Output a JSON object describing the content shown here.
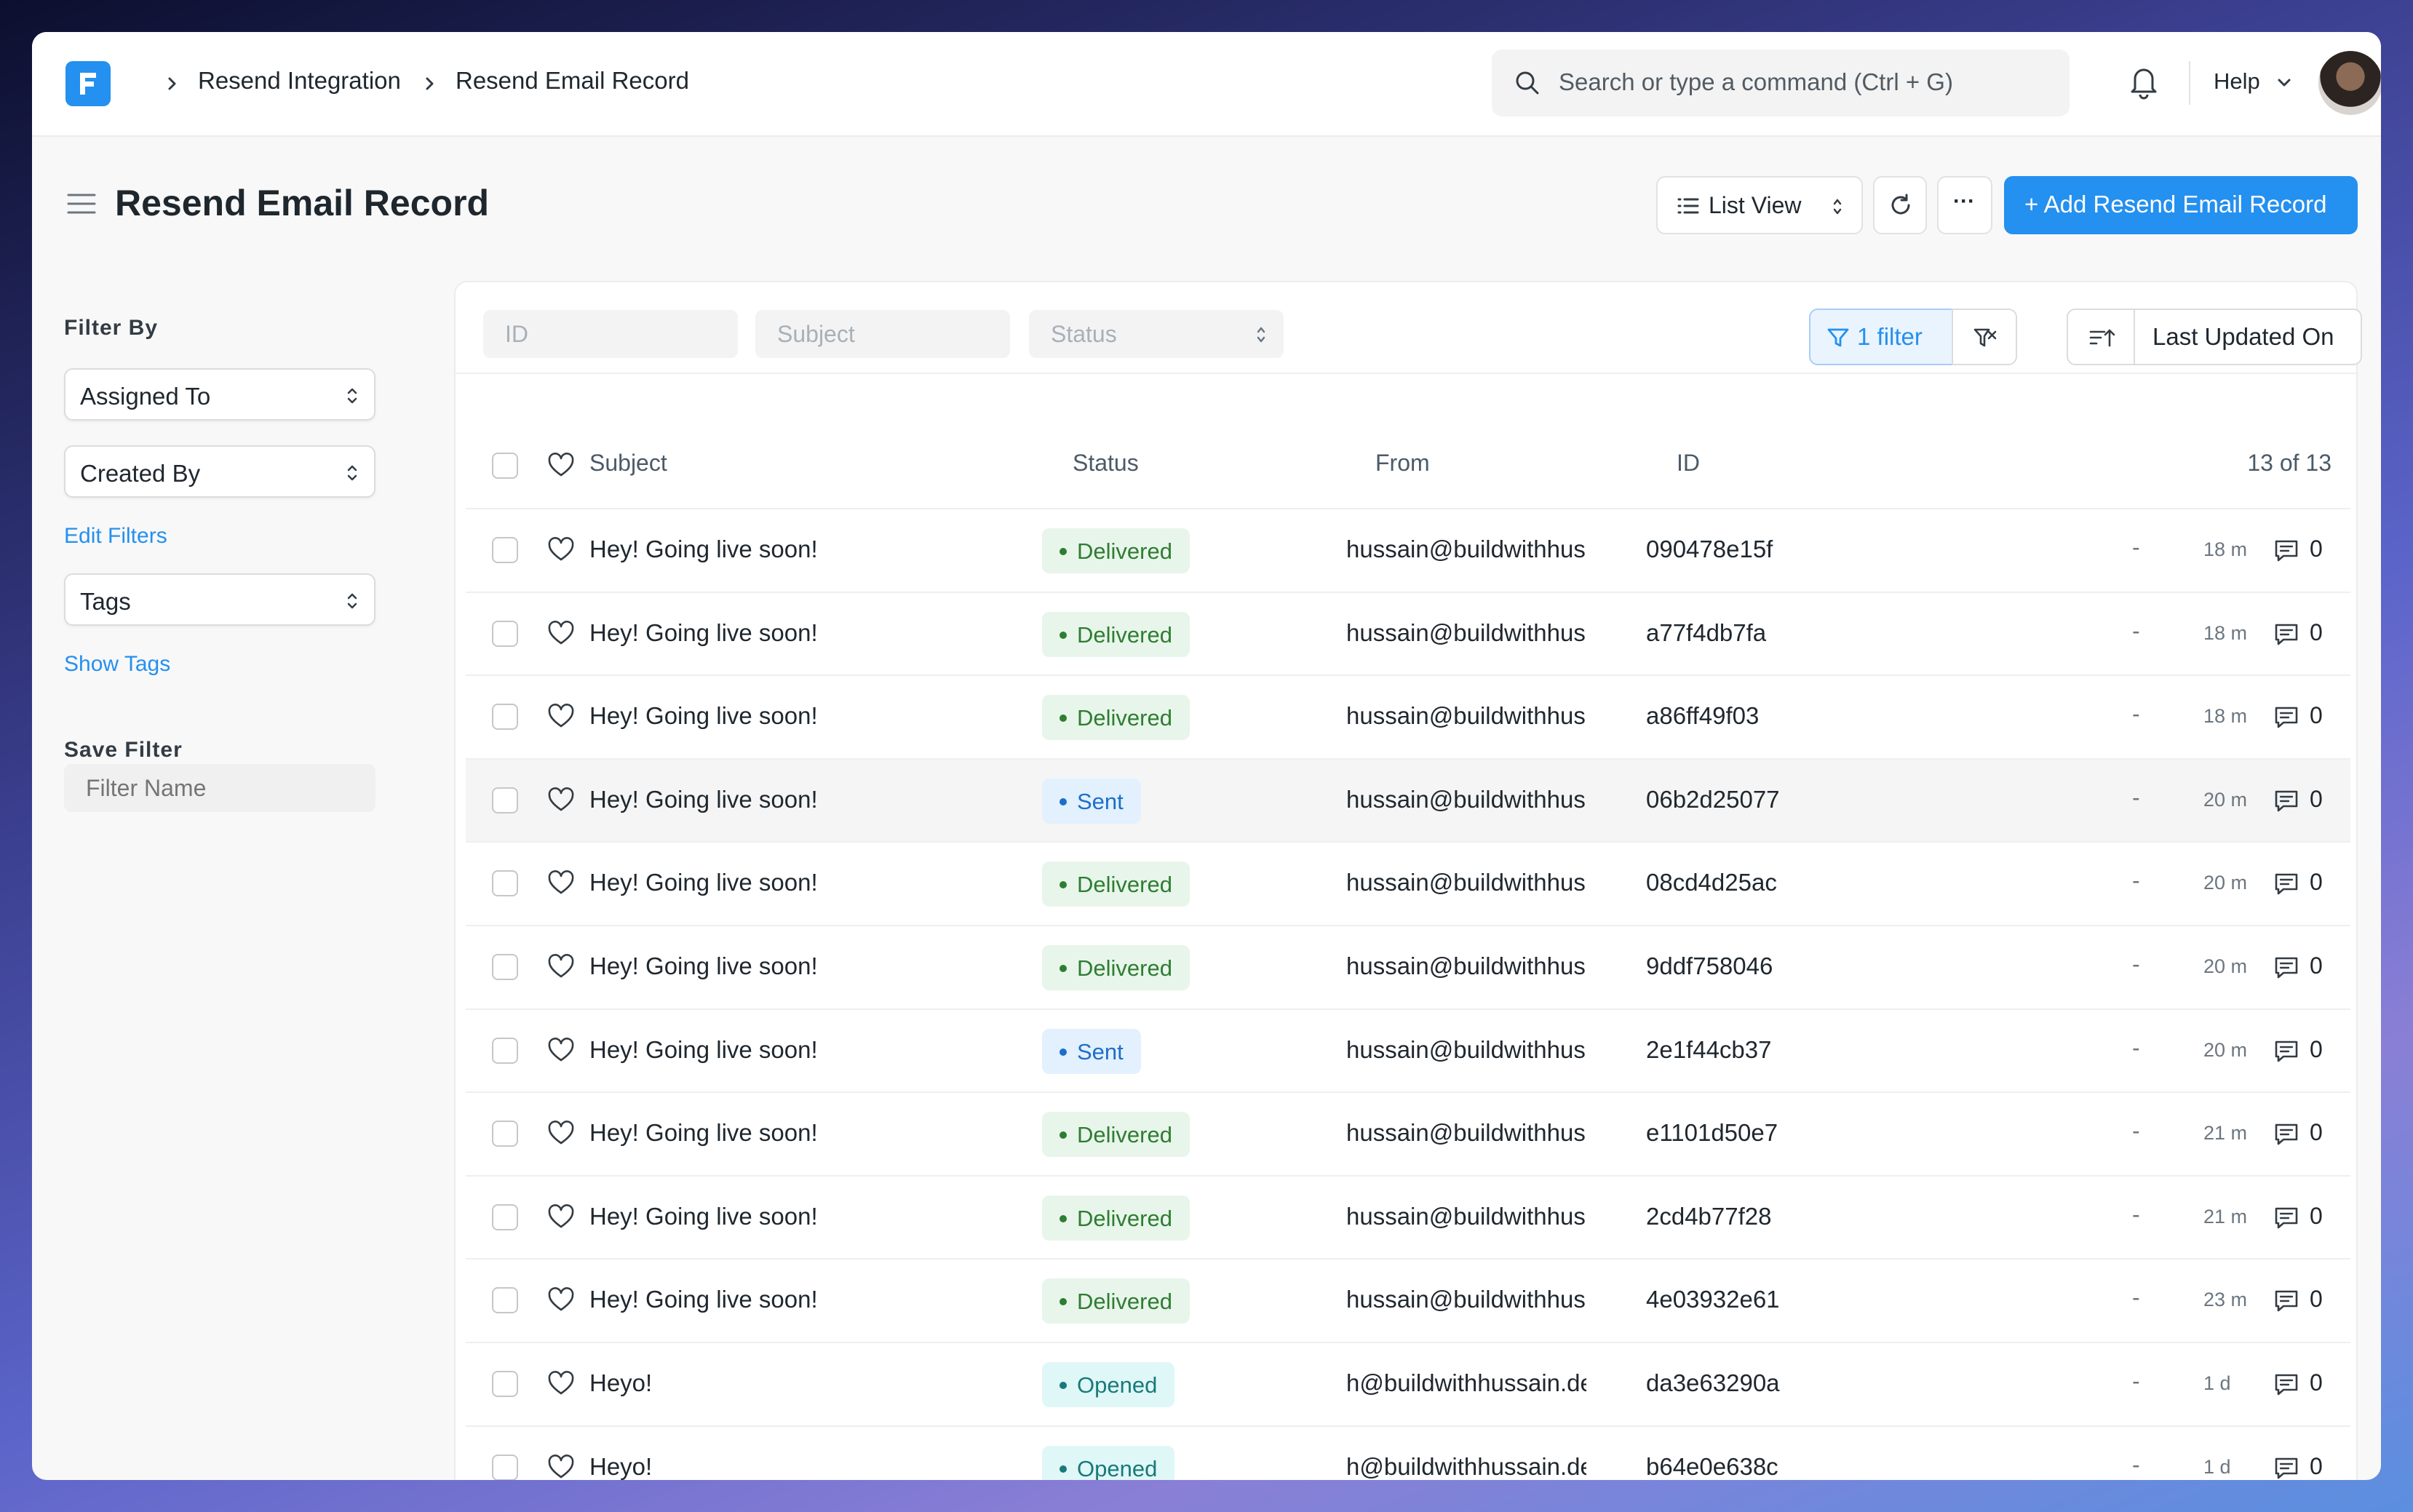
{
  "navbar": {
    "breadcrumbs": [
      "Resend Integration",
      "Resend Email Record"
    ],
    "search_placeholder": "Search or type a command (Ctrl + G)",
    "help_label": "Help"
  },
  "page": {
    "title": "Resend Email Record",
    "list_view_label": "List View",
    "more_label": "···",
    "add_label": "+ Add Resend Email Record"
  },
  "sidebar": {
    "filter_by": "Filter By",
    "assigned_to": "Assigned To",
    "created_by": "Created By",
    "edit_filters": "Edit Filters",
    "tags": "Tags",
    "show_tags": "Show Tags",
    "save_filter": "Save Filter",
    "filter_name_placeholder": "Filter Name"
  },
  "filters": {
    "id_placeholder": "ID",
    "subject_placeholder": "Subject",
    "status_placeholder": "Status",
    "filter_count_label": "1 filter",
    "sort_label": "Last Updated On"
  },
  "table": {
    "headers": {
      "subject": "Subject",
      "status": "Status",
      "from": "From",
      "id": "ID"
    },
    "count": "13 of 13",
    "rows": [
      {
        "subject": "Hey! Going live soon!",
        "status": "Delivered",
        "from": "hussain@buildwithhus...",
        "id": "090478e15f",
        "dash": "-",
        "time": "18 m",
        "comments": "0"
      },
      {
        "subject": "Hey! Going live soon!",
        "status": "Delivered",
        "from": "hussain@buildwithhus...",
        "id": "a77f4db7fa",
        "dash": "-",
        "time": "18 m",
        "comments": "0"
      },
      {
        "subject": "Hey! Going live soon!",
        "status": "Delivered",
        "from": "hussain@buildwithhus...",
        "id": "a86ff49f03",
        "dash": "-",
        "time": "18 m",
        "comments": "0"
      },
      {
        "subject": "Hey! Going live soon!",
        "status": "Sent",
        "from": "hussain@buildwithhus...",
        "id": "06b2d25077",
        "dash": "-",
        "time": "20 m",
        "comments": "0"
      },
      {
        "subject": "Hey! Going live soon!",
        "status": "Delivered",
        "from": "hussain@buildwithhus...",
        "id": "08cd4d25ac",
        "dash": "-",
        "time": "20 m",
        "comments": "0"
      },
      {
        "subject": "Hey! Going live soon!",
        "status": "Delivered",
        "from": "hussain@buildwithhus...",
        "id": "9ddf758046",
        "dash": "-",
        "time": "20 m",
        "comments": "0"
      },
      {
        "subject": "Hey! Going live soon!",
        "status": "Sent",
        "from": "hussain@buildwithhus...",
        "id": "2e1f44cb37",
        "dash": "-",
        "time": "20 m",
        "comments": "0"
      },
      {
        "subject": "Hey! Going live soon!",
        "status": "Delivered",
        "from": "hussain@buildwithhus...",
        "id": "e1101d50e7",
        "dash": "-",
        "time": "21 m",
        "comments": "0"
      },
      {
        "subject": "Hey! Going live soon!",
        "status": "Delivered",
        "from": "hussain@buildwithhus...",
        "id": "2cd4b77f28",
        "dash": "-",
        "time": "21 m",
        "comments": "0"
      },
      {
        "subject": "Hey! Going live soon!",
        "status": "Delivered",
        "from": "hussain@buildwithhus...",
        "id": "4e03932e61",
        "dash": "-",
        "time": "23 m",
        "comments": "0"
      },
      {
        "subject": "Heyo!",
        "status": "Opened",
        "from": "h@buildwithhussain.dev",
        "id": "da3e63290a",
        "dash": "-",
        "time": "1 d",
        "comments": "0"
      },
      {
        "subject": "Heyo!",
        "status": "Opened",
        "from": "h@buildwithhussain.dev",
        "id": "b64e0e638c",
        "dash": "-",
        "time": "1 d",
        "comments": "0"
      }
    ]
  },
  "colors": {
    "accent": "#2490ef",
    "delivered": "#2e7d32",
    "sent": "#1c6fc8",
    "opened": "#187a7a"
  }
}
